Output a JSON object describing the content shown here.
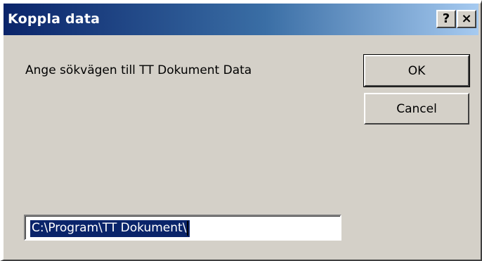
{
  "window": {
    "title": "Koppla data"
  },
  "titlebar": {
    "help_glyph": "?",
    "close_glyph": "×",
    "help_icon": "question-mark-icon",
    "close_icon": "close-icon"
  },
  "dialog": {
    "prompt": "Ange sökvägen till TT Dokument Data",
    "ok_label": "OK",
    "cancel_label": "Cancel",
    "path_value": "C:\\Program\\TT Dokument\\"
  },
  "colors": {
    "title_gradient_start": "#0a246a",
    "title_gradient_end": "#a6caf0",
    "face": "#d4d0c8",
    "selection": "#0a246a"
  }
}
